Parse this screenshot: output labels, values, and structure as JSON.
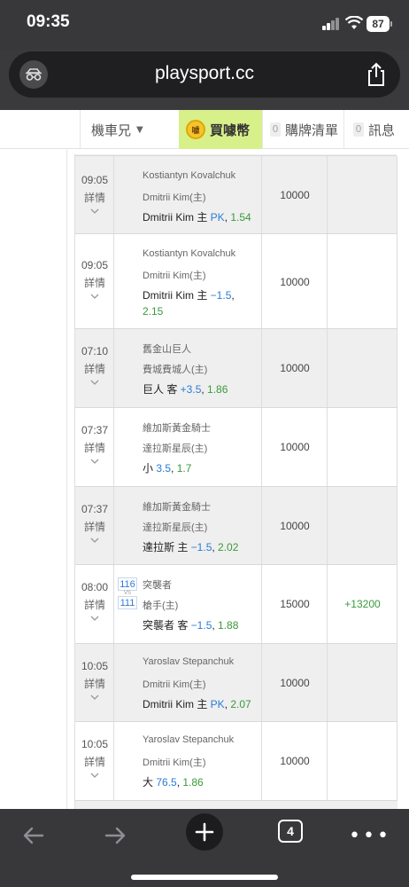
{
  "status": {
    "time": "09:35",
    "battery": "87"
  },
  "browser": {
    "url": "playsport.cc",
    "tabs_count": "4"
  },
  "header": {
    "user_name": "機車兄",
    "buy_label": "買噱幣",
    "coin_label": "噱",
    "cart_count": "0",
    "cart_label": "購牌清單",
    "msg_count": "0",
    "msg_label": "訊息"
  },
  "detail_label": "詳情",
  "rows": [
    {
      "time": "09:05",
      "team1": "Kostiantyn Kovalchuk",
      "team2": "Dmitrii Kim(主)",
      "pick_text": "Dmitrii Kim 主 ",
      "pick_blue": "PK",
      "pick_sep": ", ",
      "pick_green": "1.54",
      "amount": "10000",
      "result": ""
    },
    {
      "time": "09:05",
      "team1": "Kostiantyn Kovalchuk",
      "team2": "Dmitrii Kim(主)",
      "pick_text": "Dmitrii Kim 主 ",
      "pick_blue": "−1.5",
      "pick_sep": ",",
      "pick_green": "2.15",
      "amount": "10000",
      "result": ""
    },
    {
      "time": "07:10",
      "team1": "舊金山巨人",
      "team2": "費城費城人(主)",
      "pick_text": "巨人 客 ",
      "pick_blue": "+3.5",
      "pick_sep": ", ",
      "pick_green": "1.86",
      "amount": "10000",
      "result": ""
    },
    {
      "time": "07:37",
      "team1": "維加斯黃金騎士",
      "team2": "達拉斯星辰(主)",
      "pick_text": "小 ",
      "pick_blue": "3.5",
      "pick_sep": ", ",
      "pick_green": "1.7",
      "amount": "10000",
      "result": ""
    },
    {
      "time": "07:37",
      "team1": "維加斯黃金騎士",
      "team2": "達拉斯星辰(主)",
      "pick_text": "達拉斯 主 ",
      "pick_blue": "−1.5",
      "pick_sep": ", ",
      "pick_green": "2.02",
      "amount": "10000",
      "result": ""
    },
    {
      "time": "08:00",
      "team1": "突襲者",
      "team2": "槍手(主)",
      "score1": "116",
      "score_vs": "VS",
      "score2": "111",
      "pick_text": "突襲者 客 ",
      "pick_blue": "−1.5",
      "pick_sep": ", ",
      "pick_green": "1.88",
      "amount": "15000",
      "result": "+13200"
    },
    {
      "time": "10:05",
      "team1": "Yaroslav Stepanchuk",
      "team2": "Dmitrii Kim(主)",
      "pick_text": "Dmitrii Kim 主 ",
      "pick_blue": "PK",
      "pick_sep": ", ",
      "pick_green": "2.07",
      "amount": "10000",
      "result": ""
    },
    {
      "time": "10:05",
      "team1": "Yaroslav Stepanchuk",
      "team2": "Dmitrii Kim(主)",
      "pick_text": "大 ",
      "pick_blue": "76.5",
      "pick_sep": ", ",
      "pick_green": "1.86",
      "amount": "10000",
      "result": ""
    }
  ]
}
